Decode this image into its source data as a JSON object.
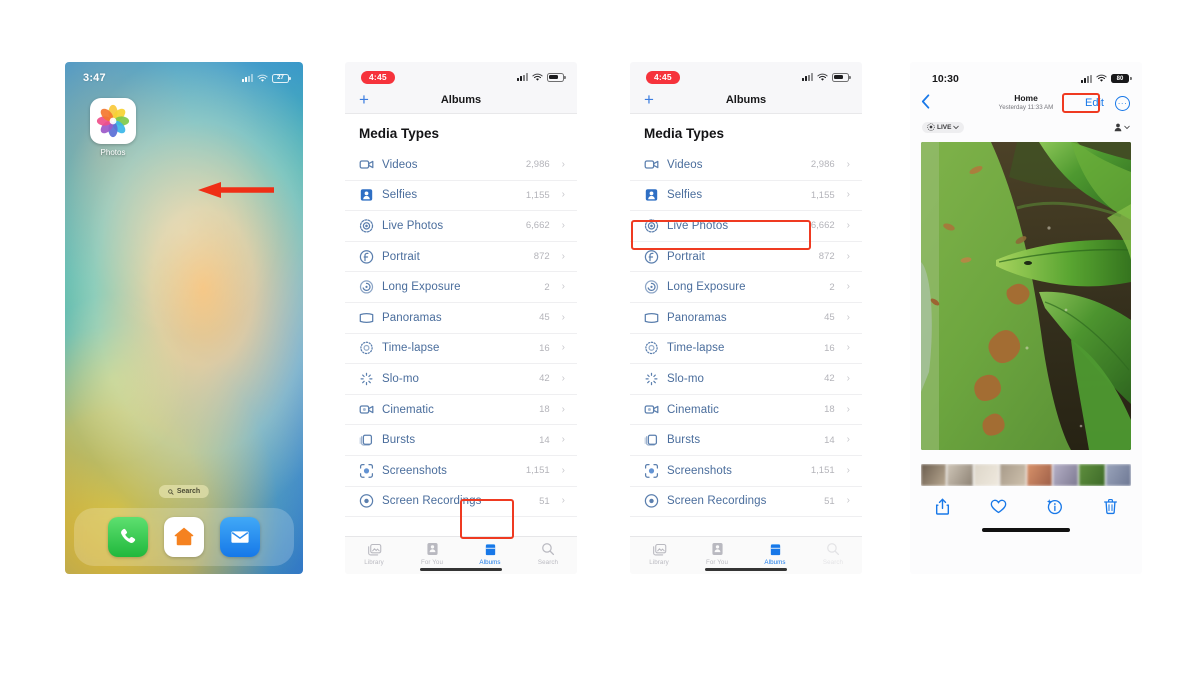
{
  "meta": {
    "accent_red": "#ef3a21",
    "ios_blue": "#1878e8",
    "row_label_blue": "#4a6d9c"
  },
  "screen_home": {
    "status": {
      "time": "3:47",
      "battery_level": "27",
      "signal_icon": "signal-bars-icon",
      "wifi_icon": "wifi-icon",
      "battery_icon": "battery-icon"
    },
    "app": {
      "label": "Photos",
      "icon": "photos-pinwheel-icon"
    },
    "annotation_arrow": "red-arrow-pointing-left",
    "search": {
      "label": "Search",
      "icon": "search-icon"
    },
    "dock": [
      {
        "name": "Phone",
        "icon": "phone-icon"
      },
      {
        "name": "Home",
        "icon": "home-icon"
      },
      {
        "name": "Mail",
        "icon": "mail-icon"
      }
    ]
  },
  "screen_albums": {
    "status": {
      "time": "4:45",
      "signal_icon": "signal-bars-icon",
      "wifi_icon": "wifi-icon",
      "battery_icon": "battery-icon"
    },
    "navbar": {
      "add_label": "+",
      "title": "Albums"
    },
    "section_title": "Media Types",
    "rows": [
      {
        "label": "Videos",
        "count": "2,986",
        "icon": "video-camera-icon"
      },
      {
        "label": "Selfies",
        "count": "1,155",
        "icon": "selfie-person-icon"
      },
      {
        "label": "Live Photos",
        "count": "6,662",
        "icon": "live-photo-icon"
      },
      {
        "label": "Portrait",
        "count": "872",
        "icon": "aperture-f-icon"
      },
      {
        "label": "Long Exposure",
        "count": "2",
        "icon": "long-exposure-icon"
      },
      {
        "label": "Panoramas",
        "count": "45",
        "icon": "panorama-icon"
      },
      {
        "label": "Time-lapse",
        "count": "16",
        "icon": "timelapse-icon"
      },
      {
        "label": "Slo-mo",
        "count": "42",
        "icon": "slomo-icon"
      },
      {
        "label": "Cinematic",
        "count": "18",
        "icon": "cinematic-icon"
      },
      {
        "label": "Bursts",
        "count": "14",
        "icon": "bursts-icon"
      },
      {
        "label": "Screenshots",
        "count": "1,151",
        "icon": "screenshot-icon"
      },
      {
        "label": "Screen Recordings",
        "count": "51",
        "icon": "screen-recording-icon"
      }
    ],
    "tabs": [
      {
        "label": "Library",
        "icon": "library-icon"
      },
      {
        "label": "For You",
        "icon": "for-you-icon"
      },
      {
        "label": "Albums",
        "icon": "albums-icon"
      },
      {
        "label": "Search",
        "icon": "search-icon"
      }
    ],
    "chevron": "›"
  },
  "screen_photo": {
    "status": {
      "time": "10:30",
      "battery_level": "80",
      "signal_icon": "signal-bars-icon",
      "wifi_icon": "wifi-icon",
      "battery_icon": "battery-icon"
    },
    "navbar": {
      "back_icon": "chevron-left-icon",
      "title": "Home",
      "subtitle": "Yesterday  11:33 AM",
      "edit_label": "Edit",
      "more_label": "···"
    },
    "subbar": {
      "live_label": "LIVE",
      "live_icon": "live-photo-icon",
      "live_chevron": "⌄",
      "person_icon": "person-icon",
      "person_chevron": "⌄"
    },
    "photo_alt": "garden-lawn-with-large-green-leaves",
    "toolbar": [
      {
        "label": "Share",
        "icon": "share-icon"
      },
      {
        "label": "Favorite",
        "icon": "heart-icon"
      },
      {
        "label": "Info",
        "icon": "info-sparkle-icon"
      },
      {
        "label": "Delete",
        "icon": "trash-icon"
      }
    ]
  }
}
